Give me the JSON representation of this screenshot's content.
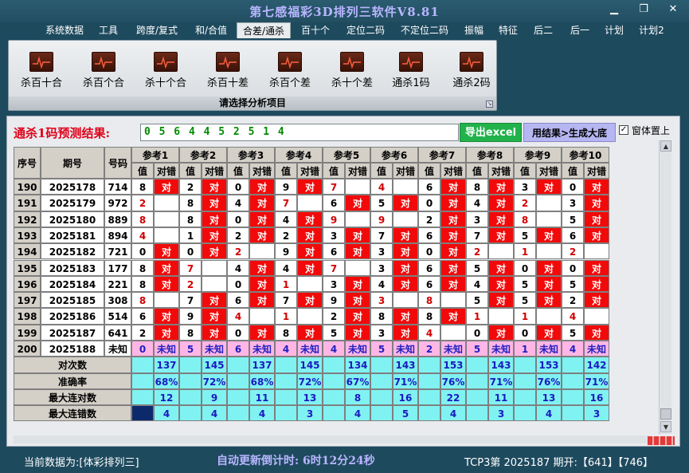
{
  "window": {
    "title": "第七感福彩3D排列三软件V8.81",
    "minimize_glyph": "▁",
    "restore_glyph": "❐",
    "close_glyph": "✕"
  },
  "menu": [
    {
      "label": "系统数据",
      "active": false
    },
    {
      "label": "工具",
      "active": false
    },
    {
      "label": "跨度/复式",
      "active": false
    },
    {
      "label": "和/合值",
      "active": false
    },
    {
      "label": "合差/通杀",
      "active": true
    },
    {
      "label": "百十个",
      "active": false
    },
    {
      "label": "定位二码",
      "active": false
    },
    {
      "label": "不定位二码",
      "active": false
    },
    {
      "label": "振幅",
      "active": false
    },
    {
      "label": "特征",
      "active": false
    },
    {
      "label": "后二",
      "active": false
    },
    {
      "label": "后一",
      "active": false
    },
    {
      "label": "计划",
      "active": false
    },
    {
      "label": "计划2",
      "active": false
    }
  ],
  "ribbon": {
    "buttons": [
      "杀百十合",
      "杀百个合",
      "杀十个合",
      "杀百十差",
      "杀百个差",
      "杀十个差",
      "通杀1码",
      "通杀2码"
    ],
    "footer": "请选择分析项目",
    "icon": "chart-line-icon"
  },
  "result": {
    "label": "通杀1码预测结果:",
    "value": "0 5 6 4 4 5 2 5 1 4",
    "export_button": "导出excel",
    "generate_button": "用结果>生成大底",
    "topmost_label": "窗体置上",
    "topmost_checked": true
  },
  "colors": {
    "red": "#f20a0a",
    "pink": "#ffb6e6",
    "cyan": "#80f2f2",
    "navy": "#0c2a6b",
    "header_bg": "#d4d0c8",
    "value_red": "#d00000"
  },
  "table": {
    "headers": {
      "seq": "序号",
      "period": "期号",
      "number": "号码"
    },
    "groups": [
      "参考1",
      "参考2",
      "参考3",
      "参考4",
      "参考5",
      "参考6",
      "参考7",
      "参考8",
      "参考9",
      "参考10"
    ],
    "sub_value": "值",
    "sub_result": "对错",
    "right_mark": "对",
    "rows": [
      {
        "seq": "190",
        "period": "2025178",
        "number": "714",
        "cells": [
          [
            "8",
            "R"
          ],
          [
            "2",
            "R"
          ],
          [
            "0",
            "R"
          ],
          [
            "9",
            "R"
          ],
          [
            "7X",
            ""
          ],
          [
            "4X",
            ""
          ],
          [
            "6",
            "R"
          ],
          [
            "8",
            "R"
          ],
          [
            "3",
            "R"
          ],
          [
            "0",
            "R"
          ]
        ]
      },
      {
        "seq": "191",
        "period": "2025179",
        "number": "972",
        "cells": [
          [
            "2X",
            ""
          ],
          [
            "8",
            "R"
          ],
          [
            "4",
            "R"
          ],
          [
            "7X",
            ""
          ],
          [
            "6",
            "R"
          ],
          [
            "5",
            "R"
          ],
          [
            "0",
            "R"
          ],
          [
            "4",
            "R"
          ],
          [
            "2X",
            ""
          ],
          [
            "3",
            "R"
          ]
        ]
      },
      {
        "seq": "192",
        "period": "2025180",
        "number": "889",
        "cells": [
          [
            "8X",
            ""
          ],
          [
            "8",
            "R"
          ],
          [
            "0",
            "R"
          ],
          [
            "4",
            "R"
          ],
          [
            "9X",
            ""
          ],
          [
            "9X",
            ""
          ],
          [
            "2",
            "R"
          ],
          [
            "3",
            "R"
          ],
          [
            "8X",
            ""
          ],
          [
            "5",
            "R"
          ]
        ]
      },
      {
        "seq": "193",
        "period": "2025181",
        "number": "894",
        "cells": [
          [
            "4X",
            ""
          ],
          [
            "1",
            "R"
          ],
          [
            "2",
            "R"
          ],
          [
            "2",
            "R"
          ],
          [
            "3",
            "R"
          ],
          [
            "7",
            "R"
          ],
          [
            "6",
            "R"
          ],
          [
            "7",
            "R"
          ],
          [
            "5",
            "R"
          ],
          [
            "6",
            "R"
          ]
        ]
      },
      {
        "seq": "194",
        "period": "2025182",
        "number": "721",
        "cells": [
          [
            "0",
            "R"
          ],
          [
            "0",
            "R"
          ],
          [
            "2X",
            ""
          ],
          [
            "9",
            "R"
          ],
          [
            "6",
            "R"
          ],
          [
            "3",
            "R"
          ],
          [
            "0",
            "R"
          ],
          [
            "2X",
            ""
          ],
          [
            "1X",
            ""
          ],
          [
            "2X",
            ""
          ]
        ]
      },
      {
        "seq": "195",
        "period": "2025183",
        "number": "177",
        "cells": [
          [
            "8",
            "R"
          ],
          [
            "7X",
            ""
          ],
          [
            "4",
            "R"
          ],
          [
            "4",
            "R"
          ],
          [
            "7X",
            ""
          ],
          [
            "3",
            "R"
          ],
          [
            "6",
            "R"
          ],
          [
            "5",
            "R"
          ],
          [
            "0",
            "R"
          ],
          [
            "0",
            "R"
          ]
        ]
      },
      {
        "seq": "196",
        "period": "2025184",
        "number": "221",
        "cells": [
          [
            "8",
            "R"
          ],
          [
            "2X",
            ""
          ],
          [
            "0",
            "R"
          ],
          [
            "1X",
            ""
          ],
          [
            "3",
            "R"
          ],
          [
            "4",
            "R"
          ],
          [
            "6",
            "R"
          ],
          [
            "4",
            "R"
          ],
          [
            "5",
            "R"
          ],
          [
            "5",
            "R"
          ]
        ]
      },
      {
        "seq": "197",
        "period": "2025185",
        "number": "308",
        "cells": [
          [
            "8X",
            ""
          ],
          [
            "7",
            "R"
          ],
          [
            "6",
            "R"
          ],
          [
            "7",
            "R"
          ],
          [
            "9",
            "R"
          ],
          [
            "3X",
            ""
          ],
          [
            "8X",
            ""
          ],
          [
            "5",
            "R"
          ],
          [
            "5",
            "R"
          ],
          [
            "2",
            "R"
          ]
        ]
      },
      {
        "seq": "198",
        "period": "2025186",
        "number": "514",
        "cells": [
          [
            "6",
            "R"
          ],
          [
            "9",
            "R"
          ],
          [
            "4X",
            ""
          ],
          [
            "1X",
            ""
          ],
          [
            "2",
            "R"
          ],
          [
            "8",
            "R"
          ],
          [
            "8",
            "R"
          ],
          [
            "1X",
            ""
          ],
          [
            "1X",
            ""
          ],
          [
            "4X",
            ""
          ]
        ]
      },
      {
        "seq": "199",
        "period": "2025187",
        "number": "641",
        "cells": [
          [
            "2",
            "R"
          ],
          [
            "8",
            "R"
          ],
          [
            "0",
            "R"
          ],
          [
            "8",
            "R"
          ],
          [
            "5",
            "R"
          ],
          [
            "3",
            "R"
          ],
          [
            "4X",
            ""
          ],
          [
            "0",
            "R"
          ],
          [
            "0",
            "R"
          ],
          [
            "5",
            "R"
          ]
        ]
      }
    ],
    "pending_row": {
      "seq": "200",
      "period": "2025188",
      "number": "未知",
      "values": [
        "0",
        "5",
        "6",
        "4",
        "4",
        "5",
        "2",
        "5",
        "1",
        "4"
      ],
      "mark": "未知"
    },
    "stats": [
      {
        "label": "对次数",
        "values": [
          "137",
          "145",
          "137",
          "145",
          "134",
          "143",
          "153",
          "143",
          "153",
          "142"
        ]
      },
      {
        "label": "准确率",
        "values": [
          "68%",
          "72%",
          "68%",
          "72%",
          "67%",
          "71%",
          "76%",
          "71%",
          "76%",
          "71%"
        ]
      },
      {
        "label": "最大连对数",
        "values": [
          "12",
          "9",
          "11",
          "13",
          "8",
          "16",
          "22",
          "11",
          "13",
          "16"
        ]
      },
      {
        "label": "最大连错数",
        "values": [
          "4",
          "4",
          "4",
          "3",
          "4",
          "5",
          "4",
          "3",
          "4",
          "3"
        ]
      }
    ]
  },
  "status": {
    "current": "当前数据为:[体彩排列三]",
    "countdown": "自动更新倒计时:  6时12分24秒",
    "draw": "TCP3第 2025187 期开:【641】【746】"
  }
}
